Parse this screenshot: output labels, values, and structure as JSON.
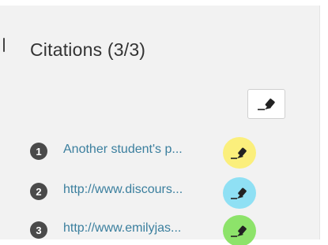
{
  "citations": {
    "title": "Citations (3/3)",
    "items": [
      {
        "number": "1",
        "label": "Another student's p...",
        "color": "#fbef7c"
      },
      {
        "number": "2",
        "label": "http://www.discours...",
        "color": "#8fe0f4"
      },
      {
        "number": "3",
        "label": "http://www.emilyjas...",
        "color": "#8de36a"
      }
    ]
  },
  "icons": {
    "tool_button": "highlighter-icon",
    "row_marker": "highlighter-icon"
  }
}
